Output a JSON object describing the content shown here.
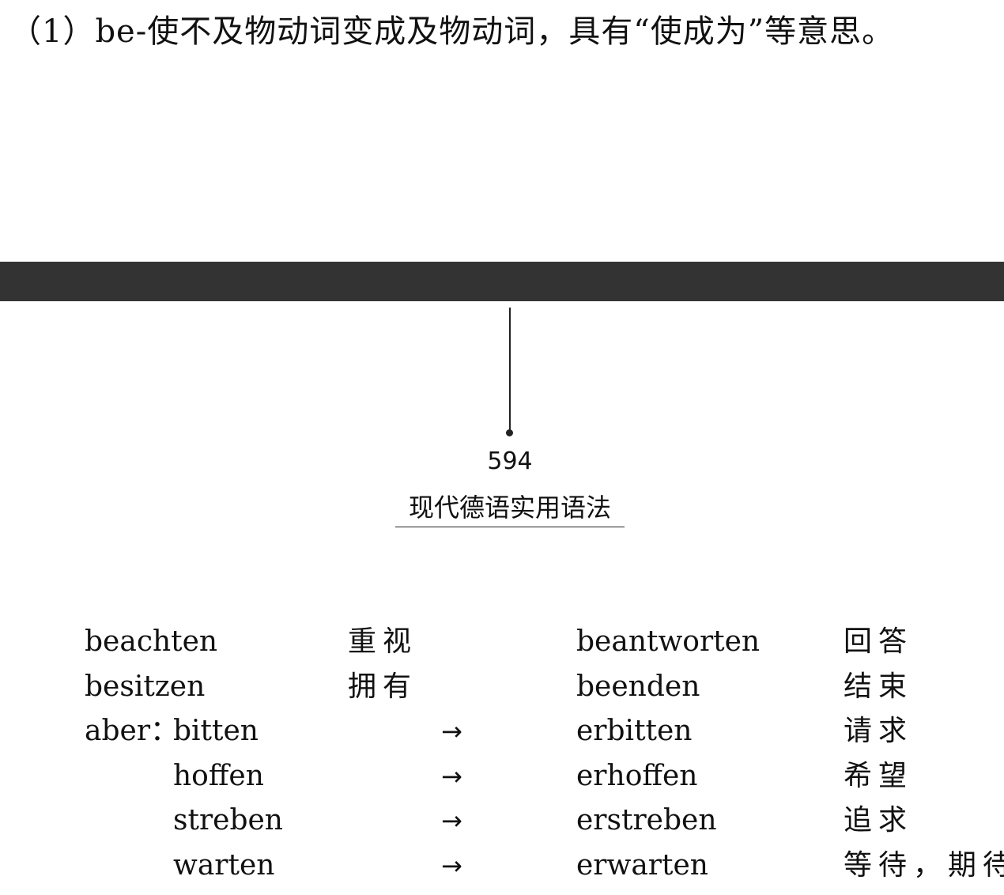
{
  "heading": "（1）be-使不及物动词变成及物动词，具有“使成为”等意思。",
  "page_number": "594",
  "book_title": "现代德语实用语法",
  "arrow_symbol": "→",
  "rows": [
    {
      "prefix": "",
      "base": "beachten",
      "base_meaning": "重视",
      "arrow": "",
      "derived": "beantworten",
      "derived_meaning": "回答"
    },
    {
      "prefix": "",
      "base": "besitzen",
      "base_meaning": "拥有",
      "arrow": "",
      "derived": "beenden",
      "derived_meaning": "结束"
    },
    {
      "prefix": "aber：",
      "base": "bitten",
      "base_meaning": "",
      "arrow": "→",
      "derived": "erbitten",
      "derived_meaning": "请求"
    },
    {
      "prefix": "",
      "base": "hoffen",
      "base_meaning": "",
      "arrow": "→",
      "derived": "erhoffen",
      "derived_meaning": "希望"
    },
    {
      "prefix": "",
      "base": "streben",
      "base_meaning": "",
      "arrow": "→",
      "derived": "erstreben",
      "derived_meaning": "追求"
    },
    {
      "prefix": "",
      "base": "warten",
      "base_meaning": "",
      "arrow": "→",
      "derived": "erwarten",
      "derived_meaning": "等待，期待"
    }
  ]
}
